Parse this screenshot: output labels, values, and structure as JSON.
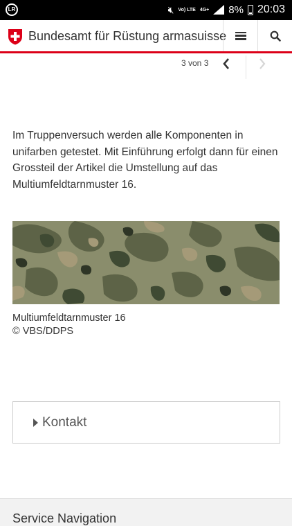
{
  "status_bar": {
    "left_icon": "LR",
    "network_label_top": "Vo) LTE",
    "network_type": "4G+",
    "battery_percent": "8%",
    "time": "20:03"
  },
  "header": {
    "site_title": "Bundesamt für Rüstung armasuisse",
    "menu_icon": "hamburger-icon",
    "search_icon": "search-icon",
    "accent_color": "#dc0018"
  },
  "pager": {
    "counter": "3 von 3",
    "prev_icon": "chevron-left-icon",
    "next_icon": "chevron-right-icon"
  },
  "content": {
    "paragraph": "Im Truppenversuch werden alle Komponenten in unifarben getestet. Mit Einführung erfolgt dann für einen Grossteil der Artikel die Umstellung auf das Multiumfeldtarnmuster 16.",
    "caption_title": "Multiumfeldtarnmuster 16",
    "caption_credit": "© VBS/DDPS"
  },
  "accordion": {
    "label": "Kontakt"
  },
  "footer": {
    "title": "Service Navigation"
  }
}
